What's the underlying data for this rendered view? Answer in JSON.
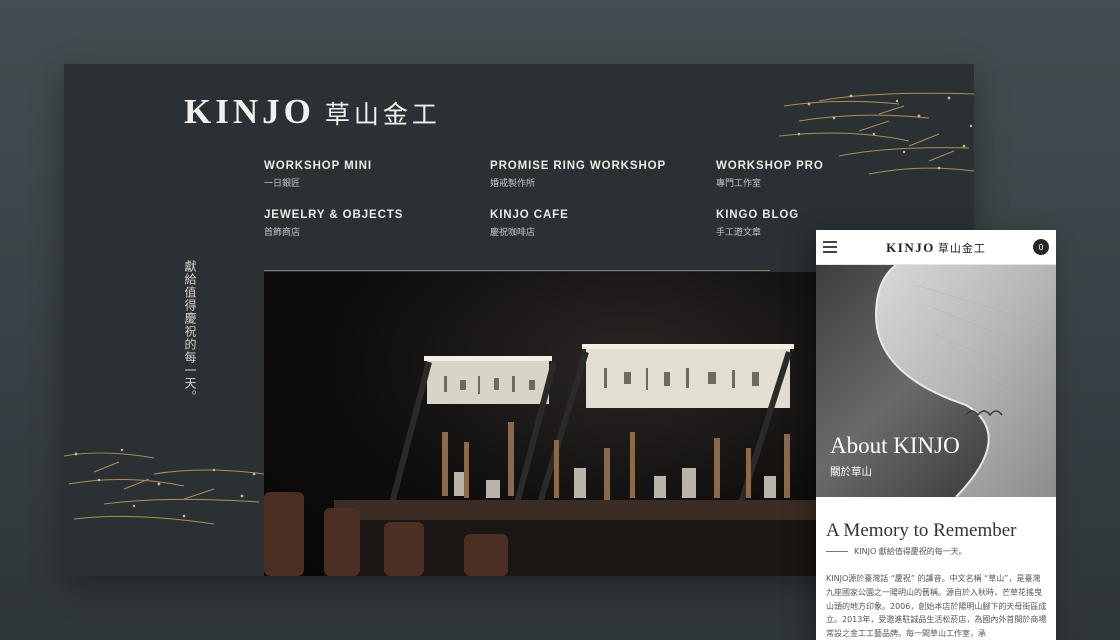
{
  "desktop": {
    "logo": {
      "latin": "KINJO",
      "cjk": "草山金工"
    },
    "nav": [
      {
        "en": "WORKSHOP MINI",
        "zh": "一日銀匠"
      },
      {
        "en": "PROMISE RING WORKSHOP",
        "zh": "婚戒製作所"
      },
      {
        "en": "WORKSHOP PRO",
        "zh": "專門工作室"
      },
      {
        "en": "JEWELRY & OBJECTS",
        "zh": "首飾商店"
      },
      {
        "en": "KINJO CAFE",
        "zh": "慶祝咖啡店"
      },
      {
        "en": "KINGO BLOG",
        "zh": "手工遊文章"
      }
    ],
    "tagline": "獻給值得慶祝的每一天。"
  },
  "mobile": {
    "logo": {
      "latin": "KINJO",
      "cjk": "草山金工"
    },
    "cart_count": "0",
    "hero": {
      "title": "About KINJO",
      "subtitle": "關於草山"
    },
    "heading": "A Memory to Remember",
    "subline": "KINJO 獻給值得慶祝的每一天。",
    "body": "KINJO源於臺灣話 “慶祝” 的譯音。中文名稱 “草山”，是臺灣九座國家公園之一陽明山的舊稱。源自於入秋時，芒草花搖曳山頭的地方印象。2006，創始本店於陽明山腳下的天母街區成立。2013年，受邀進駐誠品生活松菸店，為國內外首間於商場常設之金工工藝品牌。每一間草山工作室，承"
  },
  "colors": {
    "background": "#3c4448",
    "desktop_panel": "#2a3033",
    "gold_accent": "#c9a96b",
    "text_light": "#eceae4"
  }
}
